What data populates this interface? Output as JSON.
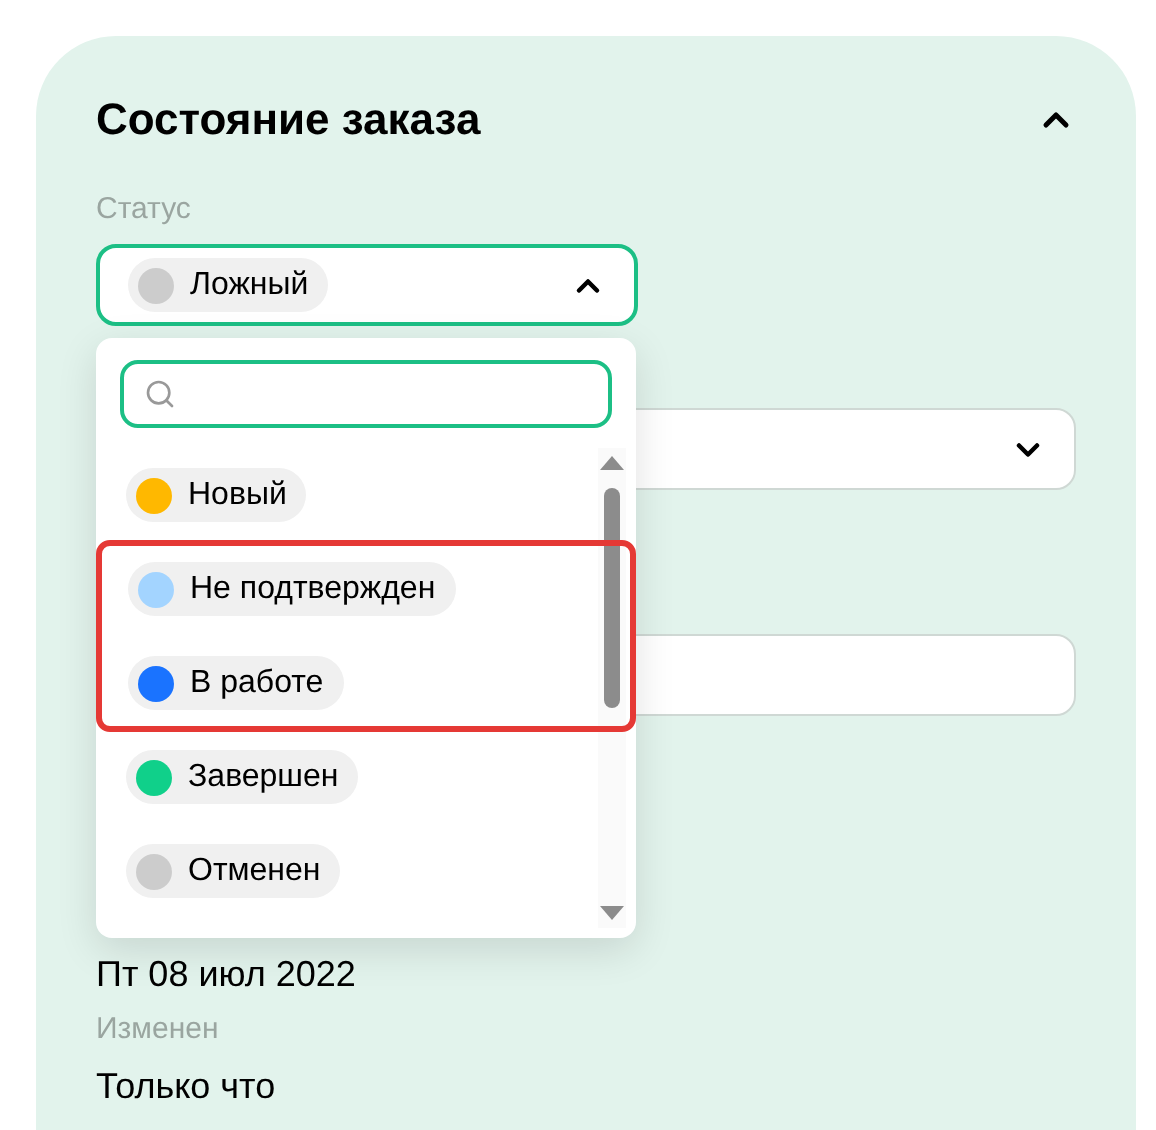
{
  "card": {
    "title": "Состояние заказа",
    "expanded": true
  },
  "status_field": {
    "label": "Статус",
    "value": "Ложный",
    "color": "#cccccc",
    "open": true
  },
  "dropdown": {
    "options": [
      {
        "label": "Новый",
        "color": "#ffb800",
        "highlighted": false
      },
      {
        "label": "Не подтвержден",
        "color": "#a3d4ff",
        "highlighted": true
      },
      {
        "label": "В работе",
        "color": "#1a73ff",
        "highlighted": true
      },
      {
        "label": "Завершен",
        "color": "#10d08a",
        "highlighted": false
      },
      {
        "label": "Отменен",
        "color": "#cccccc",
        "highlighted": false
      }
    ]
  },
  "fields": [
    {
      "kind": "select"
    },
    {
      "kind": "input"
    }
  ],
  "created_value": "Пт 08 июл 2022",
  "modified": {
    "label": "Изменен",
    "value": "Только что"
  }
}
